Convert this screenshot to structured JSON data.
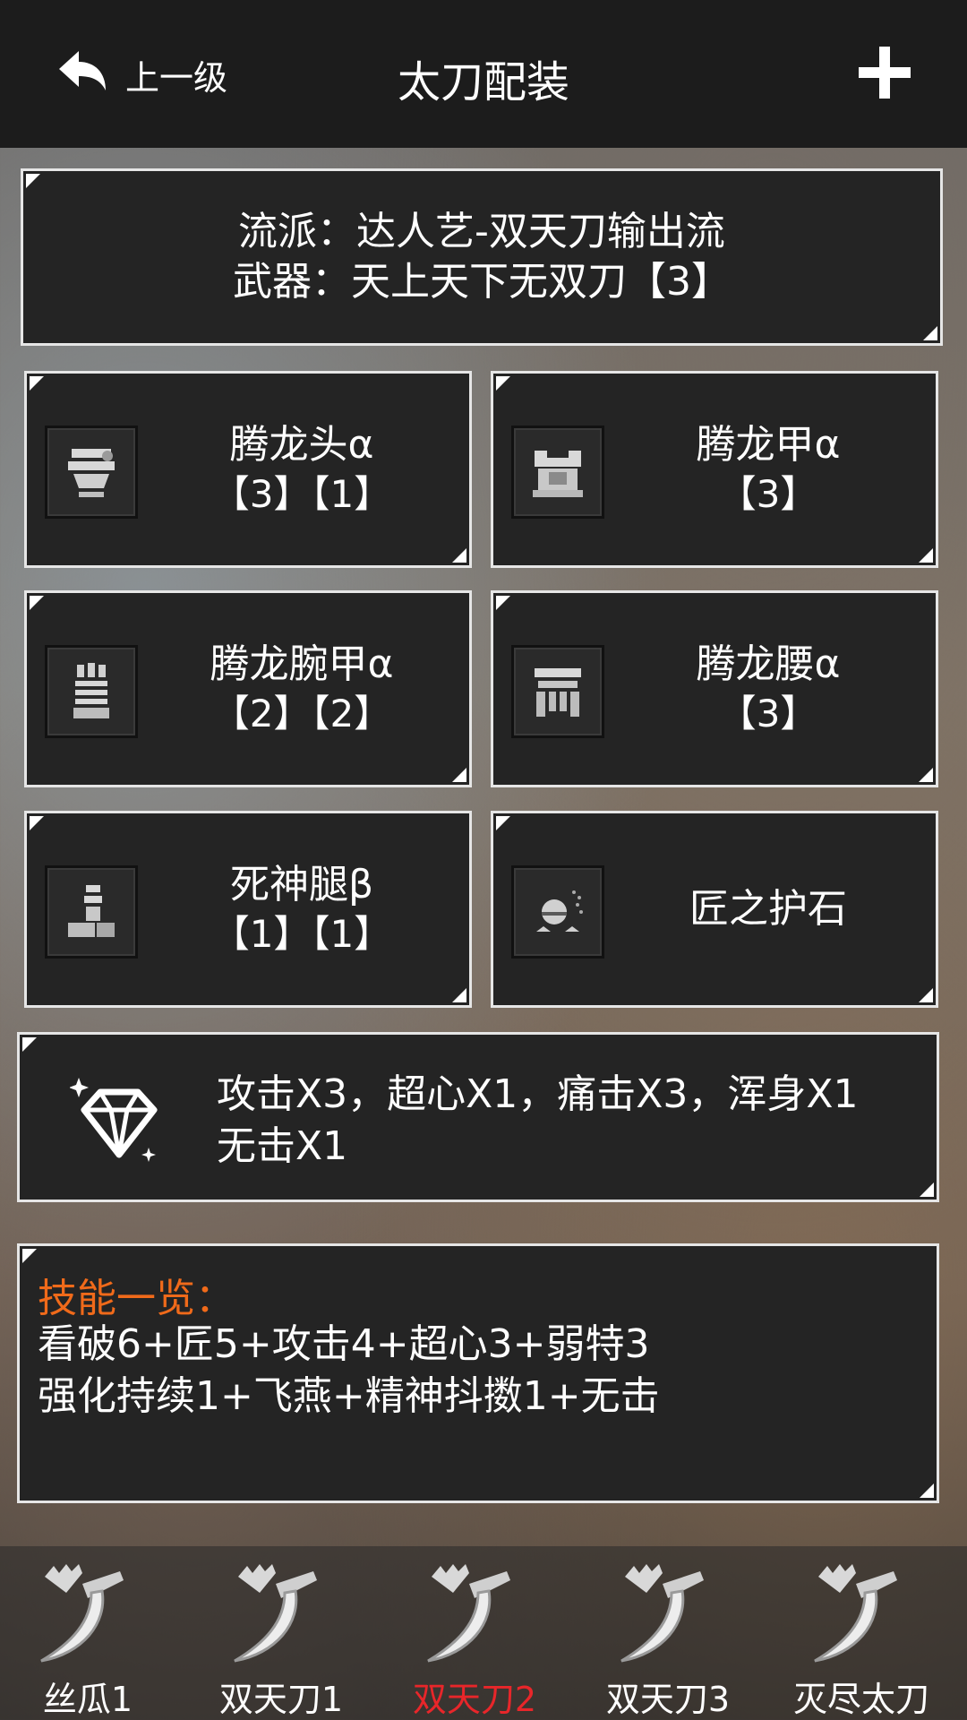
{
  "header": {
    "back_label": "上一级",
    "title": "太刀配装"
  },
  "build": {
    "style_line": "流派：达人艺-双天刀输出流",
    "weapon_line": "武器：天上天下无双刀【3】"
  },
  "gear": [
    {
      "name": "腾龙头α",
      "slots": "【3】【1】",
      "icon": "helmet-icon"
    },
    {
      "name": "腾龙甲α",
      "slots": "【3】",
      "icon": "chest-armor-icon"
    },
    {
      "name": "腾龙腕甲α",
      "slots": "【2】【2】",
      "icon": "gauntlet-icon"
    },
    {
      "name": "腾龙腰α",
      "slots": "【3】",
      "icon": "waist-armor-icon"
    },
    {
      "name": "死神腿β",
      "slots": "【1】【1】",
      "icon": "leg-armor-icon"
    },
    {
      "name": "匠之护石",
      "slots": "",
      "icon": "charm-icon"
    }
  ],
  "decorations": {
    "icon": "diamond-icon",
    "line1": "攻击X3，超心X1，痛击X3，浑身X1",
    "line2": "无击X1"
  },
  "skills": {
    "title": "技能一览：",
    "line1": "看破6+匠5+攻击4+超心3+弱特3",
    "line2": "强化持续1+飞燕+精神抖擞1+无击"
  },
  "tabs": [
    {
      "label": "丝瓜1",
      "active": false
    },
    {
      "label": "双天刀1",
      "active": false
    },
    {
      "label": "双天刀2",
      "active": true
    },
    {
      "label": "双天刀3",
      "active": false
    },
    {
      "label": "灭尽太刀",
      "active": false
    }
  ],
  "colors": {
    "accent_orange": "#f06a1a",
    "active_tab_red": "#e8262a",
    "panel_bg": "#242424",
    "header_bg": "#1c1c1c"
  }
}
